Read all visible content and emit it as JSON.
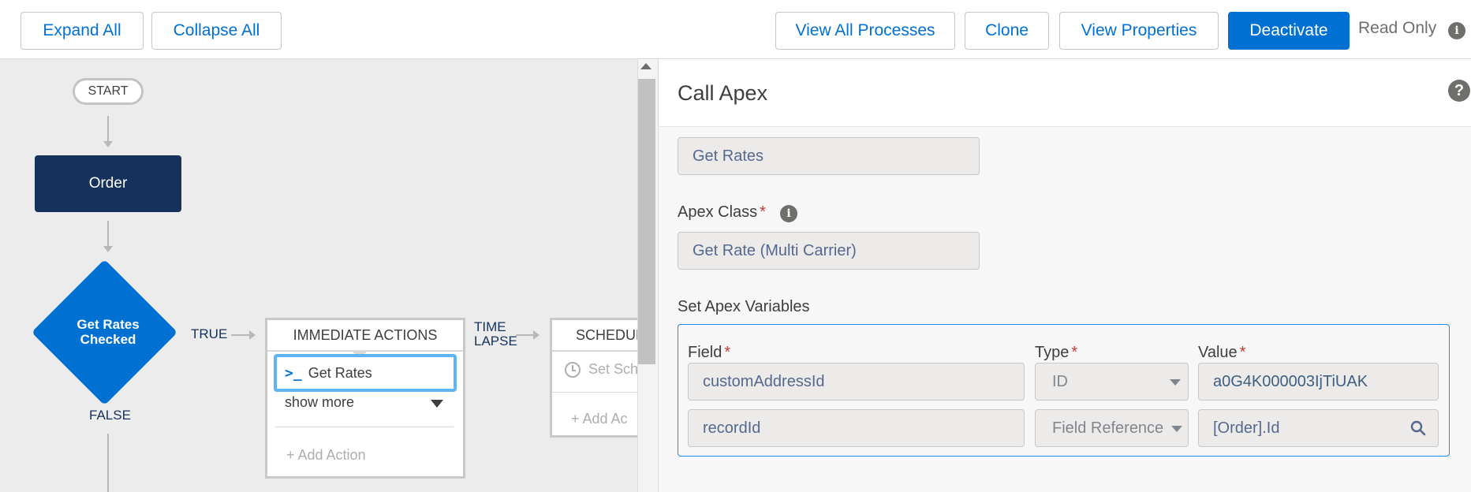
{
  "toolbar": {
    "expand_all": "Expand All",
    "collapse_all": "Collapse All",
    "view_all_processes": "View All Processes",
    "clone": "Clone",
    "view_properties": "View Properties",
    "deactivate": "Deactivate",
    "read_only": "Read Only"
  },
  "canvas": {
    "start": "START",
    "order_node": "Order",
    "decision": {
      "line1": "Get Rates",
      "line2": "Checked"
    },
    "true_label": "TRUE",
    "false_label": "FALSE",
    "time_lapse": {
      "line1": "TIME",
      "line2": "LAPSE"
    },
    "immediate": {
      "header": "IMMEDIATE ACTIONS",
      "action_icon": ">_",
      "action_label": "Get Rates",
      "show_more": "show more",
      "add_action": "+ Add Action"
    },
    "scheduled": {
      "header": "SCHEDUL",
      "action_label": "Set Sch",
      "add_action": "+ Add Ac"
    }
  },
  "panel": {
    "title": "Call Apex",
    "action_name_value": "Get Rates",
    "apex_class_label": "Apex Class",
    "apex_class_value": "Get Rate (Multi Carrier)",
    "set_variables_label": "Set Apex Variables",
    "columns": {
      "field": "Field",
      "type": "Type",
      "value": "Value"
    },
    "rows": [
      {
        "field": "customAddressId",
        "type": "ID",
        "value": "a0G4K000003IjTiUAK"
      },
      {
        "field": "recordId",
        "type": "Field Reference",
        "value": "[Order].Id"
      }
    ]
  },
  "colors": {
    "brand": "#0070d2",
    "node_dark": "#16325c",
    "required": "#c23934"
  },
  "icons": [
    "info-icon",
    "help-icon",
    "apex-icon",
    "clock-icon",
    "search-icon",
    "chevron-down-icon"
  ]
}
